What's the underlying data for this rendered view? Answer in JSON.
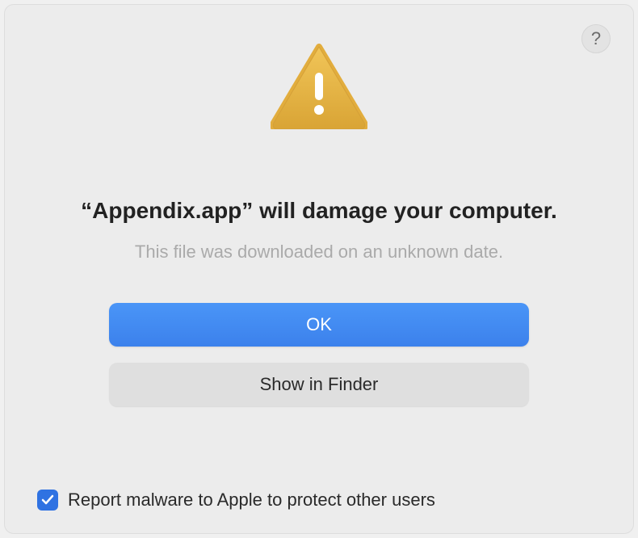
{
  "help": {
    "label": "?"
  },
  "heading": "“Appendix.app” will damage your computer.",
  "subtext": "This file was downloaded on an unknown date.",
  "buttons": {
    "ok": "OK",
    "showInFinder": "Show in Finder"
  },
  "checkbox": {
    "checked": true,
    "label": "Report malware to Apple to protect other users"
  },
  "colors": {
    "primaryButton": "#3c81ec",
    "checkboxFill": "#2f72e2",
    "warningFill": "#e2ad3d"
  }
}
